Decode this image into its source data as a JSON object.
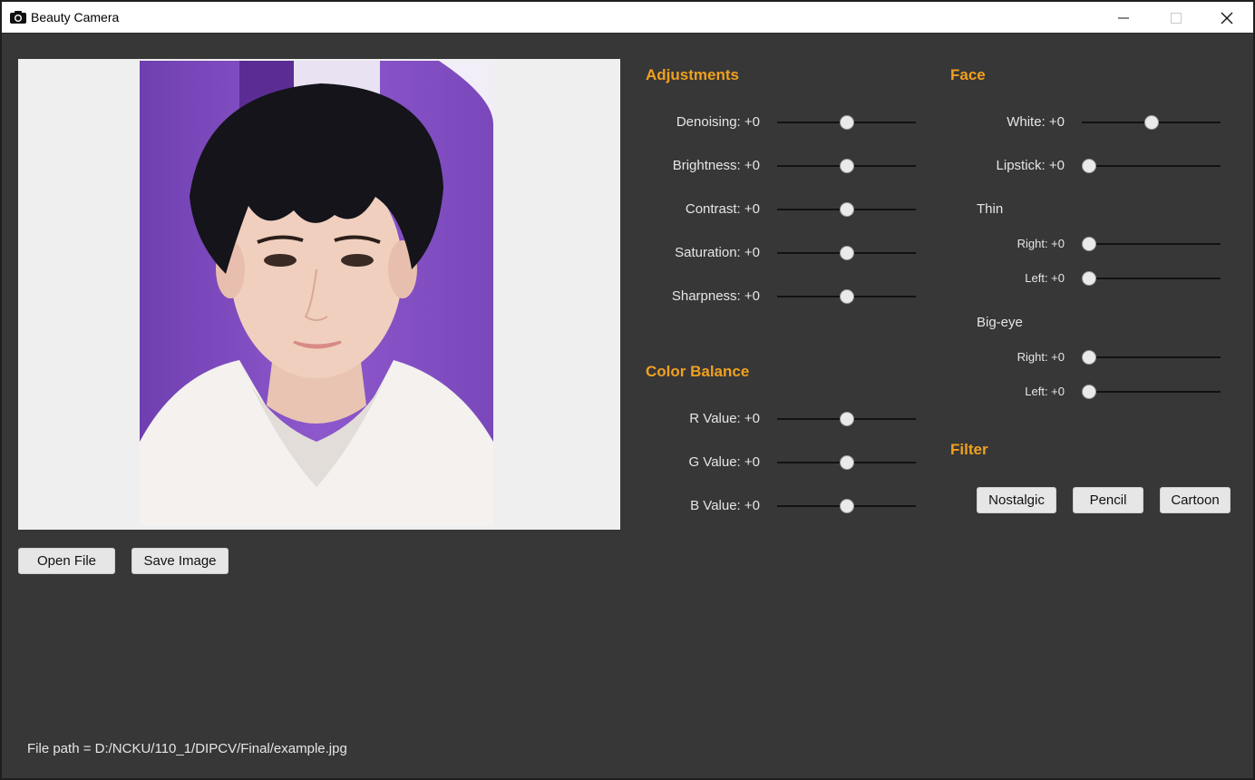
{
  "window": {
    "title": "Beauty Camera",
    "icon": "camera-icon"
  },
  "controls": {
    "minimize": "minimize-icon",
    "maximize": "maximize-icon",
    "close": "close-icon"
  },
  "buttons": {
    "open_file": "Open File",
    "save_image": "Save Image"
  },
  "adjustments": {
    "title": "Adjustments",
    "sliders": [
      {
        "label": "Denoising: +0",
        "value": 0.5
      },
      {
        "label": "Brightness: +0",
        "value": 0.5
      },
      {
        "label": "Contrast: +0",
        "value": 0.5
      },
      {
        "label": "Saturation: +0",
        "value": 0.5
      },
      {
        "label": "Sharpness: +0",
        "value": 0.5
      }
    ]
  },
  "color_balance": {
    "title": "Color Balance",
    "sliders": [
      {
        "label": "R Value: +0",
        "value": 0.5
      },
      {
        "label": "G Value: +0",
        "value": 0.5
      },
      {
        "label": "B Value: +0",
        "value": 0.5
      }
    ]
  },
  "face": {
    "title": "Face",
    "white": {
      "label": "White: +0",
      "value": 0.5
    },
    "lipstick": {
      "label": "Lipstick: +0",
      "value": 0.0
    },
    "thin": {
      "title": "Thin",
      "right": {
        "label": "Right: +0",
        "value": 0.0
      },
      "left": {
        "label": "Left: +0",
        "value": 0.0
      }
    },
    "big_eye": {
      "title": "Big-eye",
      "right": {
        "label": "Right: +0",
        "value": 0.0
      },
      "left": {
        "label": "Left: +0",
        "value": 0.0
      }
    }
  },
  "filter": {
    "title": "Filter",
    "buttons": [
      "Nostalgic",
      "Pencil",
      "Cartoon"
    ]
  },
  "status": {
    "file_path": "File path = D:/NCKU/110_1/DIPCV/Final/example.jpg"
  },
  "colors": {
    "accent": "#f0a020",
    "background": "#373737",
    "photo_backdrop": "#8a55c8"
  }
}
